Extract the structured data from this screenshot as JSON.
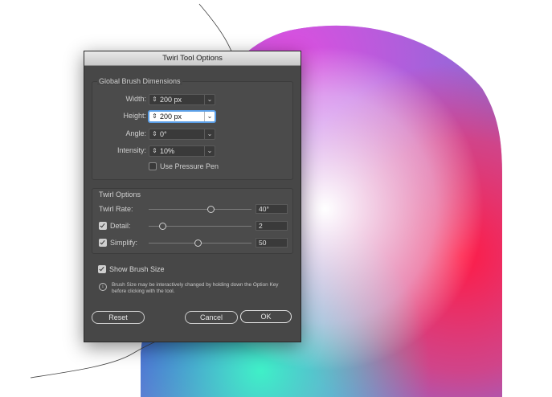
{
  "dialog": {
    "title": "Twirl Tool Options",
    "global": {
      "heading": "Global Brush Dimensions",
      "width": {
        "label": "Width:",
        "value": "200 px"
      },
      "height": {
        "label": "Height:",
        "value": "200 px"
      },
      "angle": {
        "label": "Angle:",
        "value": "0°"
      },
      "intensity": {
        "label": "Intensity:",
        "value": "10%"
      },
      "pressure_pen": {
        "label": "Use Pressure Pen",
        "checked": false
      }
    },
    "twirl": {
      "heading": "Twirl Options",
      "rate": {
        "label": "Twirl Rate:",
        "value": "40°",
        "level": 0.6
      },
      "detail": {
        "label": "Detail:",
        "value": "2",
        "checked": true,
        "level": 0.13
      },
      "simplify": {
        "label": "Simplify:",
        "value": "50",
        "checked": true,
        "level": 0.48
      }
    },
    "show_brush_size": {
      "label": "Show Brush Size",
      "checked": true
    },
    "info": "Brush Size may be interactively changed by holding down the Option Key before clicking with the tool.",
    "buttons": {
      "reset": "Reset",
      "cancel": "Cancel",
      "ok": "OK"
    }
  },
  "colors": {
    "dialog_bg": "#474747",
    "titlebar": "#d9d9d9",
    "focus_ring": "#5a9ee6"
  },
  "icons": {
    "stepper": "up-down-arrows-icon",
    "dropdown": "chevron-down-icon",
    "info": "info-circle-icon"
  }
}
